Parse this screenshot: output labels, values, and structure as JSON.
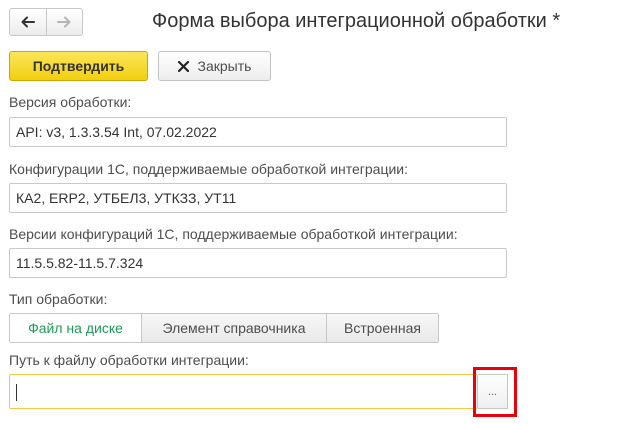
{
  "window": {
    "title": "Форма выбора интеграционной обработки *"
  },
  "nav": {
    "back_icon": "arrow-left-icon",
    "forward_icon": "arrow-right-icon"
  },
  "toolbar": {
    "confirm_label": "Подтвердить",
    "close_label": "Закрыть",
    "close_icon": "close-icon"
  },
  "fields": {
    "version": {
      "label": "Версия обработки:",
      "value": "API: v3, 1.3.3.54 Int, 07.02.2022"
    },
    "configurations": {
      "label": "Конфигурации 1С, поддерживаемые обработкой интеграции:",
      "value": "КА2, ERP2, УТБЕЛ3, УТКЗЗ, УТ11"
    },
    "config_versions": {
      "label": "Версии конфигураций 1С, поддерживаемые обработкой интеграции:",
      "value": "11.5.5.82-11.5.7.324"
    },
    "processing_type": {
      "label": "Тип обработки:",
      "options": [
        "Файл на диске",
        "Элемент справочника",
        "Встроенная"
      ],
      "selected": "Файл на диске"
    },
    "file_path": {
      "label": "Путь к файлу обработки интеграции:",
      "value": "",
      "select_button_label": "..."
    }
  },
  "colors": {
    "confirm_button": "#f5d82a",
    "active_option_text": "#1e9a56",
    "focused_input_border": "#f0c84a",
    "highlight_frame": "#e8000b"
  }
}
